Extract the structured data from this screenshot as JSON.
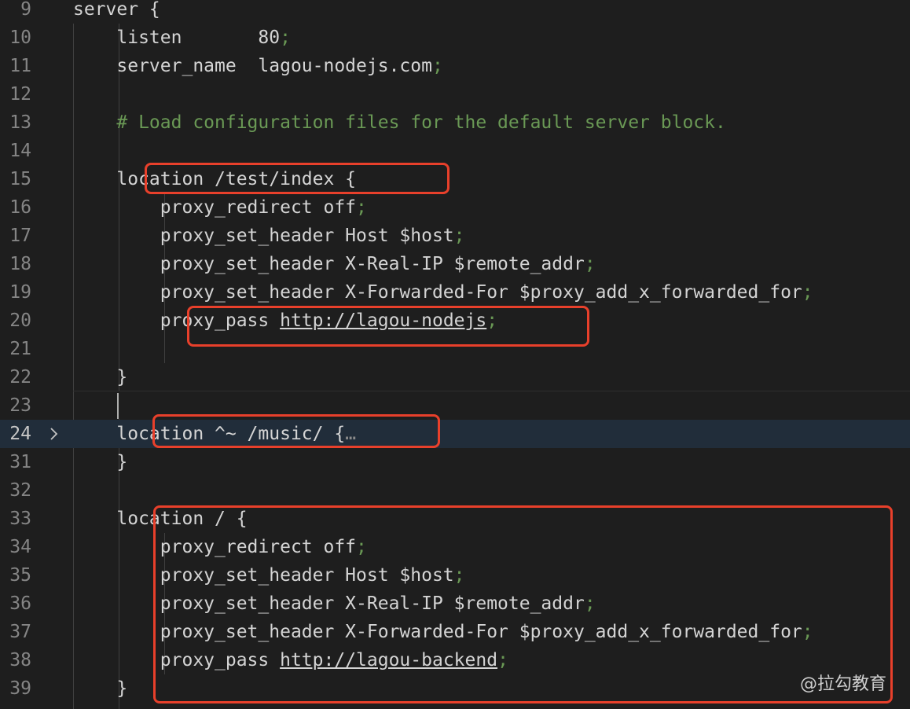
{
  "editor": {
    "lines": [
      {
        "num": "9",
        "text": "server {"
      },
      {
        "num": "10",
        "text": "    listen       80;"
      },
      {
        "num": "11",
        "text": "    server_name  lagou-nodejs.com;"
      },
      {
        "num": "12",
        "text": ""
      },
      {
        "num": "13",
        "text": "    # Load configuration files for the default server block."
      },
      {
        "num": "14",
        "text": ""
      },
      {
        "num": "15",
        "text": "    location /test/index {"
      },
      {
        "num": "16",
        "text": "        proxy_redirect off;"
      },
      {
        "num": "17",
        "text": "        proxy_set_header Host $host;"
      },
      {
        "num": "18",
        "text": "        proxy_set_header X-Real-IP $remote_addr;"
      },
      {
        "num": "19",
        "text": "        proxy_set_header X-Forwarded-For $proxy_add_x_forwarded_for;"
      },
      {
        "num": "20",
        "text": "        proxy_pass http://lagou-nodejs;"
      },
      {
        "num": "21",
        "text": ""
      },
      {
        "num": "22",
        "text": "    }"
      },
      {
        "num": "23",
        "text": ""
      },
      {
        "num": "24",
        "text": "    location ^~ /music/ {"
      },
      {
        "num": "31",
        "text": "    }"
      },
      {
        "num": "32",
        "text": ""
      },
      {
        "num": "33",
        "text": "    location / {"
      },
      {
        "num": "34",
        "text": "        proxy_redirect off;"
      },
      {
        "num": "35",
        "text": "        proxy_set_header Host $host;"
      },
      {
        "num": "36",
        "text": "        proxy_set_header X-Real-IP $remote_addr;"
      },
      {
        "num": "37",
        "text": "        proxy_set_header X-Forwarded-For $proxy_add_x_forwarded_for;"
      },
      {
        "num": "38",
        "text": "        proxy_pass http://lagou-backend;"
      },
      {
        "num": "39",
        "text": "    }"
      }
    ],
    "fold_indicator": "…",
    "active_line": "24"
  },
  "watermark": "@拉勾教育",
  "colors": {
    "background": "#1e1e1e",
    "text": "#d4d4d4",
    "line_number": "#858585",
    "comment": "#6a9955",
    "highlight_box": "#e8402b",
    "active_line_bg": "#212d3a"
  },
  "icons": {
    "fold": "chevron-right-icon"
  }
}
